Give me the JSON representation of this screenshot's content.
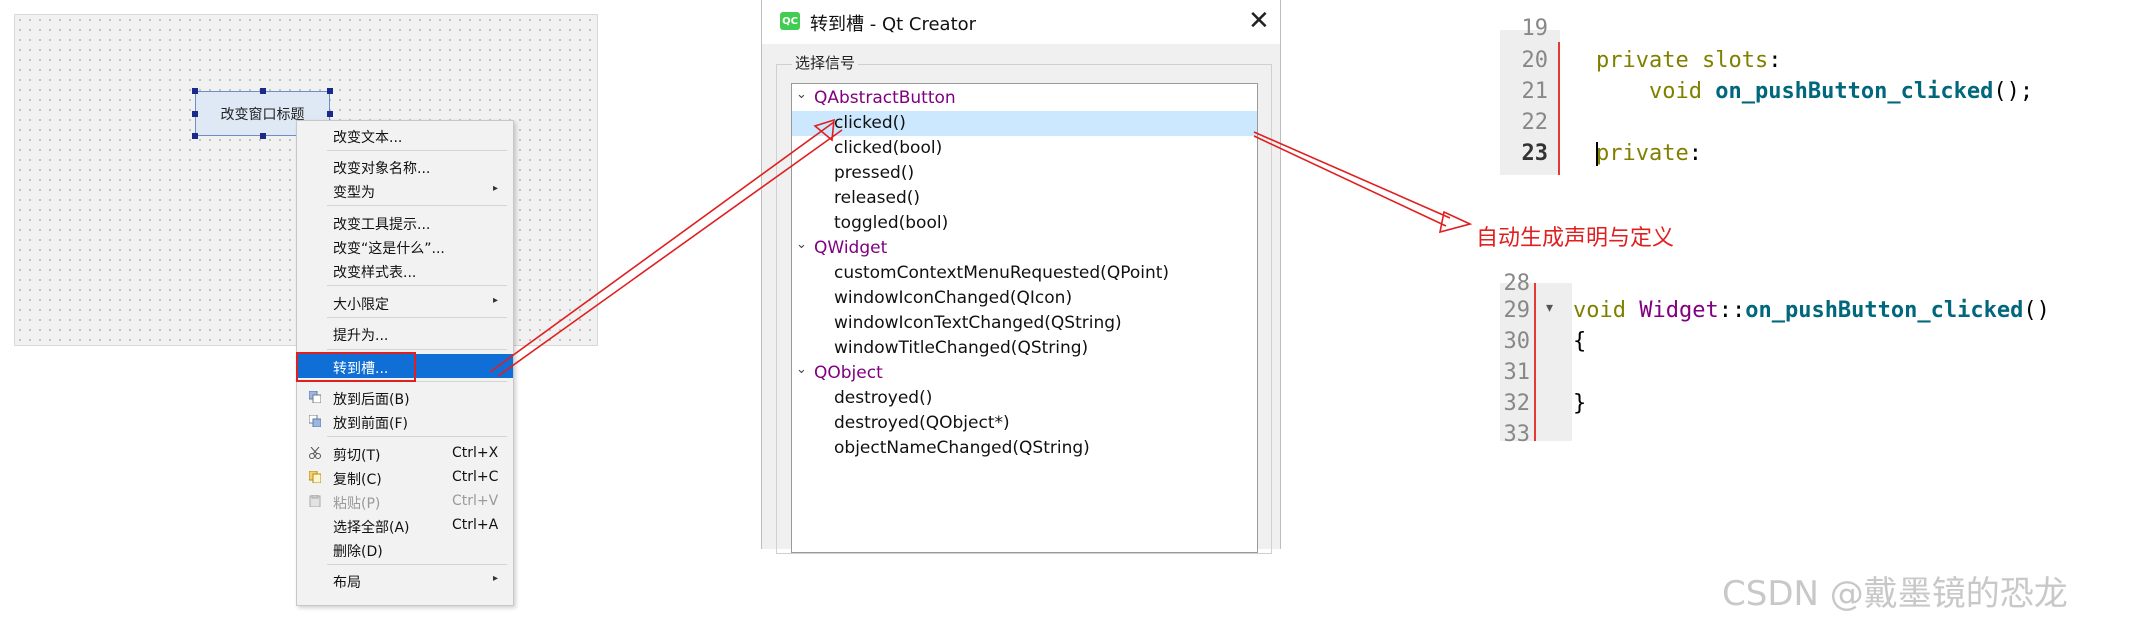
{
  "designer": {
    "button_text": "改变窗口标题"
  },
  "context_menu": {
    "items": [
      {
        "label": "改变文本..."
      },
      {
        "label": "改变对象名称..."
      },
      {
        "label": "变型为",
        "arrow": "▸"
      },
      {
        "label": "改变工具提示..."
      },
      {
        "label": "改变“这是什么”..."
      },
      {
        "label": "改变样式表..."
      },
      {
        "label": "大小限定",
        "arrow": "▸"
      },
      {
        "label": "提升为..."
      },
      {
        "label": "转到槽..."
      },
      {
        "label": "放到后面(B)"
      },
      {
        "label": "放到前面(F)"
      },
      {
        "label": "剪切(T)",
        "shortcut": "Ctrl+X"
      },
      {
        "label": "复制(C)",
        "shortcut": "Ctrl+C"
      },
      {
        "label": "粘贴(P)",
        "shortcut": "Ctrl+V"
      },
      {
        "label": "选择全部(A)",
        "shortcut": "Ctrl+A"
      },
      {
        "label": "删除(D)"
      },
      {
        "label": "布局",
        "arrow": "▸"
      }
    ]
  },
  "dialog": {
    "logo_text": "QC",
    "title": "转到槽 - Qt Creator",
    "close_glyph": "✕",
    "group_label": "选择信号",
    "tree": [
      {
        "type": "class",
        "chevron": "⌄",
        "text": "QAbstractButton"
      },
      {
        "type": "signal",
        "text": "clicked()"
      },
      {
        "type": "signal",
        "text": "clicked(bool)"
      },
      {
        "type": "signal",
        "text": "pressed()"
      },
      {
        "type": "signal",
        "text": "released()"
      },
      {
        "type": "signal",
        "text": "toggled(bool)"
      },
      {
        "type": "class",
        "chevron": "⌄",
        "text": "QWidget"
      },
      {
        "type": "signal",
        "text": "customContextMenuRequested(QPoint)"
      },
      {
        "type": "signal",
        "text": "windowIconChanged(QIcon)"
      },
      {
        "type": "signal",
        "text": "windowIconTextChanged(QString)"
      },
      {
        "type": "signal",
        "text": "windowTitleChanged(QString)"
      },
      {
        "type": "class",
        "chevron": "⌄",
        "text": "QObject"
      },
      {
        "type": "signal",
        "text": "destroyed()"
      },
      {
        "type": "signal",
        "text": "destroyed(QObject*)"
      },
      {
        "type": "signal",
        "text": "objectNameChanged(QString)"
      }
    ]
  },
  "code_header": {
    "lines": [
      {
        "num": "19",
        "kw1": "",
        "kw2": "",
        "fn": "",
        "rest": ""
      },
      {
        "num": "20",
        "kw1": "private",
        "kw2": " slots",
        "fn": "",
        "rest": ":"
      },
      {
        "num": "21",
        "kw1": "    void",
        "kw2": "",
        "fn": " on_pushButton_clicked",
        "rest": "();"
      },
      {
        "num": "22",
        "kw1": "",
        "kw2": "",
        "fn": "",
        "rest": ""
      },
      {
        "num": "23",
        "kw1": "private",
        "kw2": "",
        "fn": "",
        "rest": ":"
      }
    ]
  },
  "code_source": {
    "lines": [
      {
        "num": "28",
        "fold": "",
        "text": ""
      },
      {
        "num": "29",
        "fold": "▾",
        "text": ""
      },
      {
        "num": "30",
        "fold": "",
        "text": "{"
      },
      {
        "num": "31",
        "fold": "",
        "text": ""
      },
      {
        "num": "32",
        "fold": "",
        "text": "}"
      },
      {
        "num": "33",
        "fold": "",
        "text": ""
      }
    ],
    "def": {
      "kw": "void",
      "cls": "Widget",
      "sep": "::",
      "fn": "on_pushButton_clicked",
      "rest": "()"
    }
  },
  "annotation": "自动生成声明与定义",
  "watermark": "CSDN @戴墨镜的恐龙",
  "colors": {
    "highlight": "#0f6fd6",
    "selected_row": "#cce8ff",
    "annotation_red": "#e02020"
  }
}
